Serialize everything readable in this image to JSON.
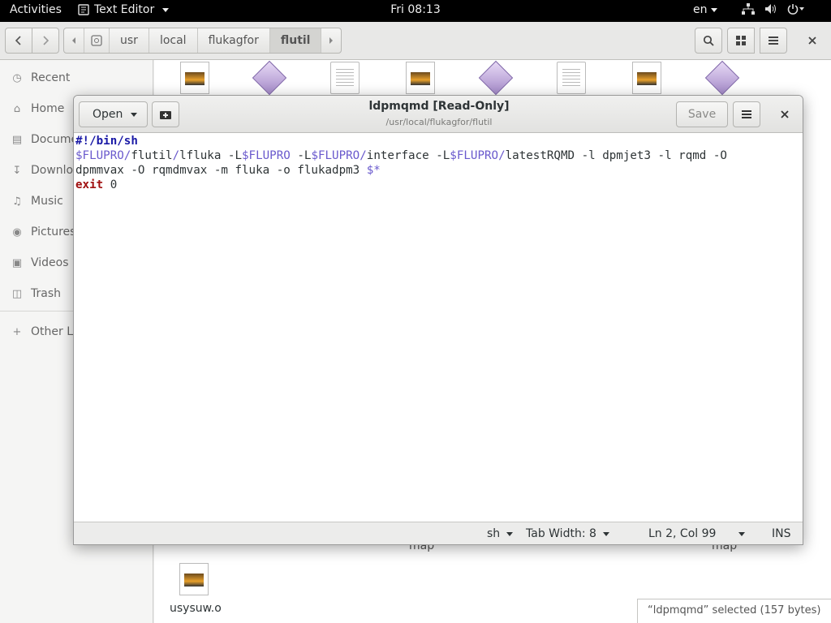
{
  "topbar": {
    "activities": "Activities",
    "app_name": "Text Editor",
    "clock": "Fri 08:13",
    "language": "en"
  },
  "files": {
    "breadcrumbs": [
      "usr",
      "local",
      "flukagfor",
      "flutil"
    ],
    "sidebar": [
      {
        "label": "Recent",
        "icon": "clock-icon"
      },
      {
        "label": "Home",
        "icon": "home-icon"
      },
      {
        "label": "Documents",
        "icon": "document-icon"
      },
      {
        "label": "Downloads",
        "icon": "download-icon"
      },
      {
        "label": "Music",
        "icon": "music-icon"
      },
      {
        "label": "Pictures",
        "icon": "camera-icon"
      },
      {
        "label": "Videos",
        "icon": "video-icon"
      },
      {
        "label": "Trash",
        "icon": "trash-icon"
      },
      {
        "label": "Other Locations",
        "icon": "plus-icon"
      }
    ],
    "partial_labels": [
      "map",
      "map"
    ],
    "visible_file": "usysuw.o",
    "selection_status": "“ldpmqmd” selected  (157 bytes)"
  },
  "editor": {
    "open_label": "Open",
    "title": "ldpmqmd [Read-Only]",
    "subtitle": "/usr/local/flukagfor/flutil",
    "save_label": "Save",
    "status": {
      "language": "sh",
      "tab_width": "Tab Width: 8",
      "position": "Ln 2, Col 99",
      "mode": "INS"
    }
  },
  "colors": {
    "shebang": "#1a1aa6",
    "variable": "#6a5acd",
    "exit_keyword": "#a01010"
  }
}
